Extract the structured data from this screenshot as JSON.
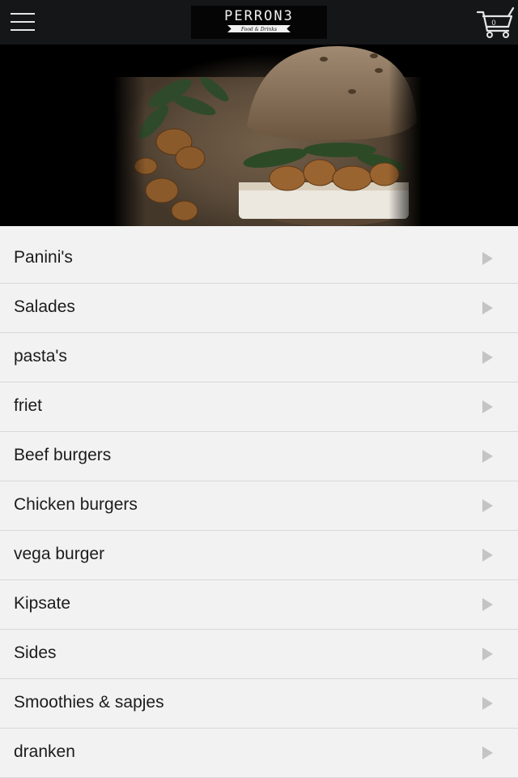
{
  "header": {
    "menu_icon": "hamburger-menu-icon",
    "logo": {
      "title": "PERRON3",
      "subtitle": "Food & Drinks"
    },
    "cart": {
      "icon": "shopping-cart-icon",
      "count": "0"
    },
    "background_color": "#151618"
  },
  "hero": {
    "image": "burger-with-walnuts-and-brie-photo"
  },
  "menu": {
    "chevron_icon": "play-arrow-icon",
    "items": [
      {
        "label": "Panini's"
      },
      {
        "label": "Salades"
      },
      {
        "label": "pasta's"
      },
      {
        "label": "friet"
      },
      {
        "label": "Beef burgers"
      },
      {
        "label": "Chicken burgers"
      },
      {
        "label": "vega burger"
      },
      {
        "label": "Kipsate"
      },
      {
        "label": "Sides"
      },
      {
        "label": "Smoothies & sapjes"
      },
      {
        "label": "dranken"
      }
    ]
  }
}
